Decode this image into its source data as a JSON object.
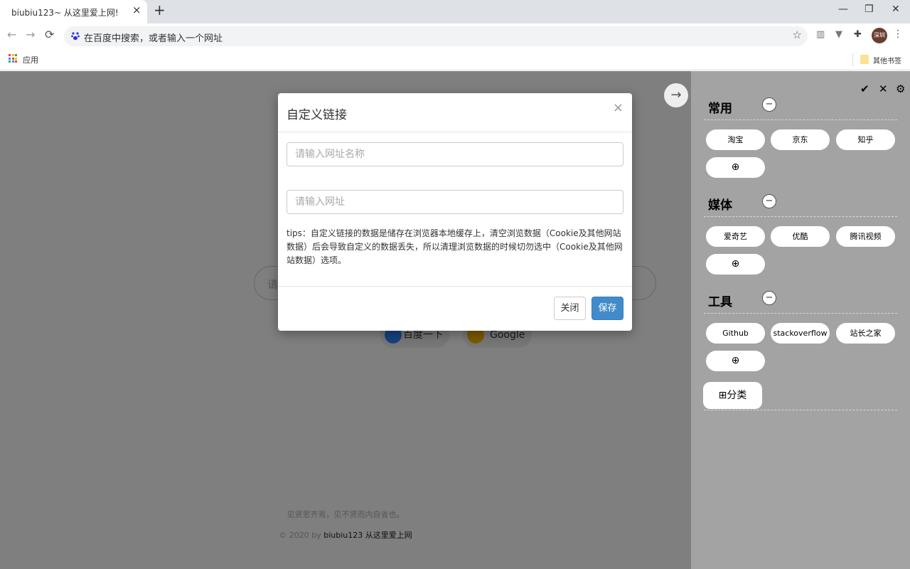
{
  "browser": {
    "tab_title": "biubiu123~ 从这里爱上网!",
    "tab_close": "×",
    "new_tab": "+",
    "window_controls": {
      "minimize": "—",
      "restore": "❐",
      "close": "✕"
    },
    "nav": {
      "back": "←",
      "forward": "→",
      "reload": "⟳"
    },
    "omnibox_text": "在百度中搜索，或者输入一个网址",
    "star": "☆",
    "extensions": [
      "▥",
      "▼",
      "✚"
    ],
    "avatar_text": "深圳",
    "menu": "⋮",
    "bookmarks": {
      "apps_label": "应用",
      "other_label": "其他书签"
    }
  },
  "page": {
    "search_placeholder": "请",
    "engines": [
      {
        "label": "百度一下",
        "icon": "baidu-icon",
        "color": "#3385ff"
      },
      {
        "label": "Google",
        "icon": "google-icon",
        "color": "#f4b400"
      }
    ],
    "footer_tagline": "见贤思齐焉，见不贤而内自省也。",
    "footer_copy_prefix": "© 2020 by",
    "footer_copy_link": "biubiu123 从这里爱上网"
  },
  "modal": {
    "title": "自定义链接",
    "close_x": "×",
    "name_placeholder": "请输入网址名称",
    "url_placeholder": "请输入网址",
    "tips": "tips：自定义链接的数据是储存在浏览器本地缓存上，清空浏览数据（Cookie及其他网站数据）后会导致自定义的数据丢失，所以清理浏览数据的时候切勿选中（Cookie及其他网站数据）选项。",
    "close_button": "关闭",
    "save_button": "保存"
  },
  "panel": {
    "arrow": "→",
    "actions": {
      "confirm": "✔",
      "cancel": "✕",
      "settings": "⚙"
    },
    "categories": [
      {
        "title": "常用",
        "minus": "−",
        "links": [
          "淘宝",
          "京东",
          "知乎"
        ],
        "add": "⊕"
      },
      {
        "title": "媒体",
        "minus": "−",
        "links": [
          "爱奇艺",
          "优酷",
          "腾讯视频"
        ],
        "add": "⊕"
      },
      {
        "title": "工具",
        "minus": "−",
        "links": [
          "Github",
          "stackoverflow",
          "站长之家"
        ],
        "add": "⊕"
      }
    ],
    "add_category": "⊞分类"
  },
  "colors": {
    "save_blue": "#428bca",
    "panel_bg": "#a3a3a3",
    "overlay": "rgba(0,0,0,0.5)"
  }
}
